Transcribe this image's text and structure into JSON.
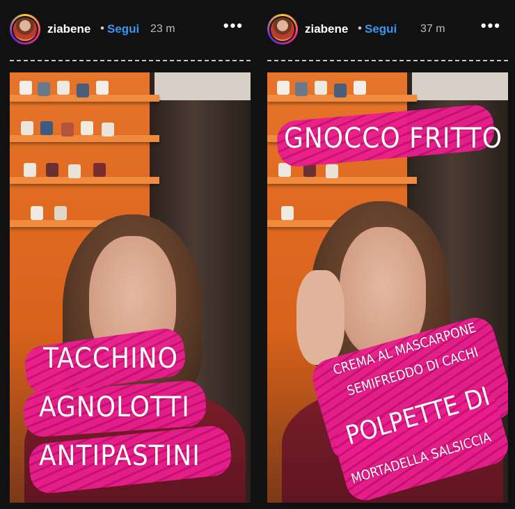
{
  "stories": [
    {
      "username": "ziabene",
      "separator": "•",
      "follow_label": "Segui",
      "time": "23 m",
      "more": "•••",
      "captions": [
        "TACCHINO",
        "AGNOLOTTI",
        "ANTIPASTINI"
      ]
    },
    {
      "username": "ziabene",
      "separator": "•",
      "follow_label": "Segui",
      "time": "37 m",
      "more": "•••",
      "captions": [
        "GNOCCO FRITTO",
        "CREMA AL MASCARPONE",
        "SEMIFREDDO DI CACHI",
        "POLPETTE DI",
        "MORTADELLA SALSICCIA"
      ]
    }
  ],
  "colors": {
    "background": "#111111",
    "follow": "#3897f0",
    "highlight": "#e91e8c",
    "wall": "#e6742a"
  },
  "icons": [
    "more-options-icon",
    "avatar"
  ]
}
